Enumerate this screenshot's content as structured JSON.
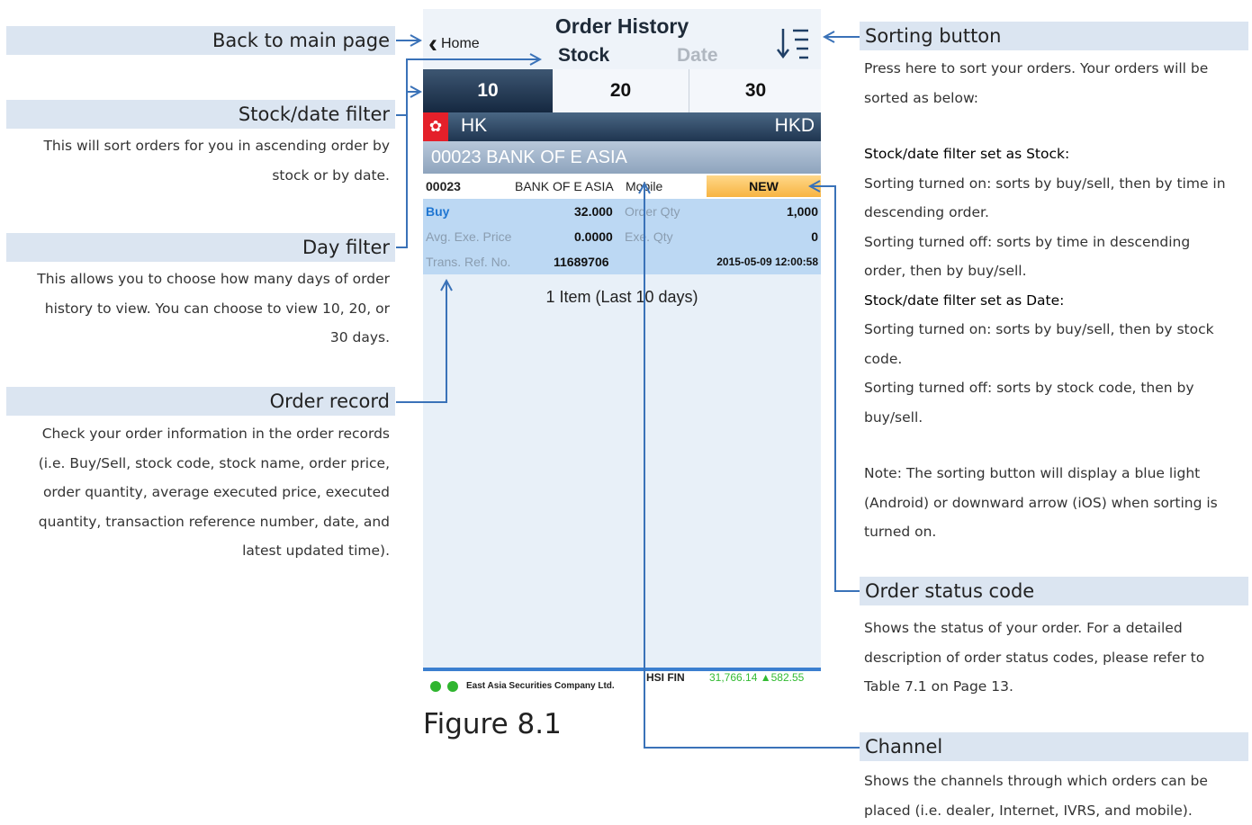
{
  "annotations": {
    "back": {
      "title": "Back to main page"
    },
    "stock_date": {
      "title": "Stock/date filter",
      "lines": [
        "This will sort orders for you in ascending order by",
        "stock or by date."
      ]
    },
    "day": {
      "title": "Day filter",
      "lines": [
        "This allows you to choose how many days of order",
        "history to view. You can choose to view 10, 20, or",
        "30 days."
      ]
    },
    "order_record": {
      "title": "Order record",
      "lines": [
        "Check your order information in the order records",
        "(i.e. Buy/Sell, stock code, stock name, order price,",
        "order quantity, average executed price, executed",
        "quantity, transaction reference number, date, and",
        "latest updated time)."
      ]
    },
    "sorting": {
      "title": "Sorting button",
      "intro": [
        "Press here to sort your orders. Your orders will be",
        "sorted as below:"
      ],
      "stock_heading": "Stock/date filter set as Stock:",
      "stock_lines": [
        "Sorting turned on: sorts by buy/sell, then by time in",
        "descending order.",
        "Sorting turned off: sorts by time in descending",
        "order, then by buy/sell."
      ],
      "date_heading": "Stock/date filter set as Date:",
      "date_lines": [
        "Sorting turned on: sorts by buy/sell, then by stock",
        "code.",
        "Sorting turned off: sorts by stock code, then by",
        "buy/sell."
      ],
      "note": [
        "Note: The sorting button will display a blue light",
        "(Android) or downward arrow (iOS) when sorting is",
        "turned on."
      ]
    },
    "status": {
      "title": "Order status code",
      "lines": [
        "Shows the status of your order. For a detailed",
        "description of order status codes, please refer to",
        "Table 7.1 on Page 13."
      ]
    },
    "channel": {
      "title": "Channel",
      "lines": [
        "Shows the channels through which orders can be",
        "placed (i.e. dealer, Internet, IVRS, and mobile)."
      ]
    }
  },
  "phone": {
    "home_label": "Home",
    "title": "Order History",
    "seg_stock": "Stock",
    "seg_date": "Date",
    "days": [
      "10",
      "20",
      "30"
    ],
    "market": "HK",
    "currency": "HKD",
    "stock_header": "00023 BANK OF E ASIA",
    "order": {
      "code": "00023",
      "name": "BANK OF E ASIA",
      "channel": "Mobile",
      "status": "NEW",
      "side": "Buy",
      "price": "32.000",
      "order_qty_label": "Order Qty",
      "order_qty": "1,000",
      "avg_label": "Avg. Exe. Price",
      "avg_price": "0.0000",
      "exe_qty_label": "Exe. Qty",
      "exe_qty": "0",
      "ref_label": "Trans. Ref. No.",
      "ref": "11689706",
      "datetime": "2015-05-09 12:00:58"
    },
    "summary": "1 Item (Last 10 days)",
    "company": "East Asia Securities Company Ltd.",
    "ticker_name": "HSI FIN",
    "ticker_value": "31,766.14 ▲582.55"
  },
  "figure_caption": "Figure 8.1",
  "colors": {
    "annotation_band": "#dbe5f1",
    "arrow": "#3a72b8",
    "status_badge": "#f7b441"
  }
}
